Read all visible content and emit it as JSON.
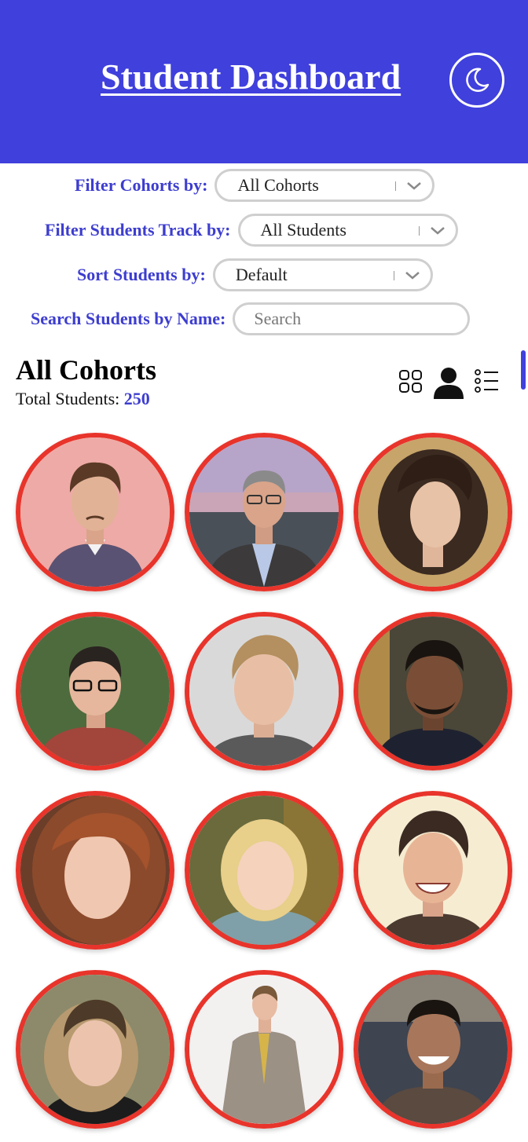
{
  "header": {
    "title": "Student Dashboard",
    "theme_toggle_icon": "moon-icon",
    "background_color": "#4040dd"
  },
  "filters": {
    "cohort_label": "Filter Cohorts by:",
    "cohort_value": "All Cohorts",
    "track_label": "Filter Students Track by:",
    "track_value": "All Students",
    "sort_label": "Sort Students by:",
    "sort_value": "Default",
    "search_label": "Search Students by Name:",
    "search_placeholder": "Search"
  },
  "section": {
    "title": "All Cohorts",
    "total_label": "Total Students:",
    "total_count": "250"
  },
  "view_modes": [
    "grid-icon",
    "person-icon",
    "list-icon"
  ],
  "colors": {
    "accent": "#3d3dcf",
    "avatar_border": "#e8342b"
  },
  "students": [
    {
      "photo": "student-photo"
    },
    {
      "photo": "student-photo"
    },
    {
      "photo": "student-photo"
    },
    {
      "photo": "student-photo"
    },
    {
      "photo": "student-photo"
    },
    {
      "photo": "student-photo"
    },
    {
      "photo": "student-photo"
    },
    {
      "photo": "student-photo"
    },
    {
      "photo": "student-photo"
    },
    {
      "photo": "student-photo"
    },
    {
      "photo": "student-photo"
    },
    {
      "photo": "student-photo"
    }
  ]
}
